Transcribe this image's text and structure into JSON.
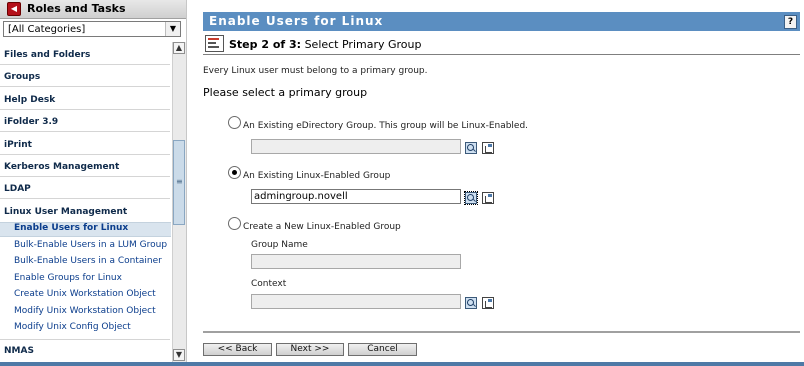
{
  "sidebar": {
    "title": "Roles and Tasks",
    "category_select": {
      "value": "[All Categories]"
    },
    "categories": [
      "Files and Folders",
      "Groups",
      "Help Desk",
      "iFolder 3.9",
      "iPrint",
      "Kerberos Management",
      "LDAP",
      "Linux User Management"
    ],
    "tasks": [
      "Enable Users for Linux",
      "Bulk-Enable Users in a LUM Group",
      "Bulk-Enable Users in a Container",
      "Enable Groups for Linux",
      "Create Unix Workstation Object",
      "Modify Unix Workstation Object",
      "Modify Unix Config Object"
    ],
    "next_category": "NMAS"
  },
  "main": {
    "title": "Enable Users for Linux",
    "help": "?",
    "step_prefix": "Step 2 of 3:",
    "step_name": "Select Primary Group",
    "intro": "Every Linux user must belong to a primary group.",
    "prompt": "Please select a primary group",
    "options": [
      {
        "label": "An Existing eDirectory Group. This group will be Linux-Enabled.",
        "selected": false,
        "value": ""
      },
      {
        "label": "An Existing Linux-Enabled Group",
        "selected": true,
        "value": "admingroup.novell"
      },
      {
        "label": "Create a New Linux-Enabled Group",
        "selected": false
      }
    ],
    "new_group": {
      "name_label": "Group Name",
      "name_value": "",
      "context_label": "Context",
      "context_value": ""
    },
    "buttons": {
      "back": "<< Back",
      "next": "Next >>",
      "cancel": "Cancel"
    }
  },
  "colors": {
    "title_bar": "#5b8ec1",
    "link": "#0b3d8c",
    "active_row": "#d9e4ee"
  }
}
